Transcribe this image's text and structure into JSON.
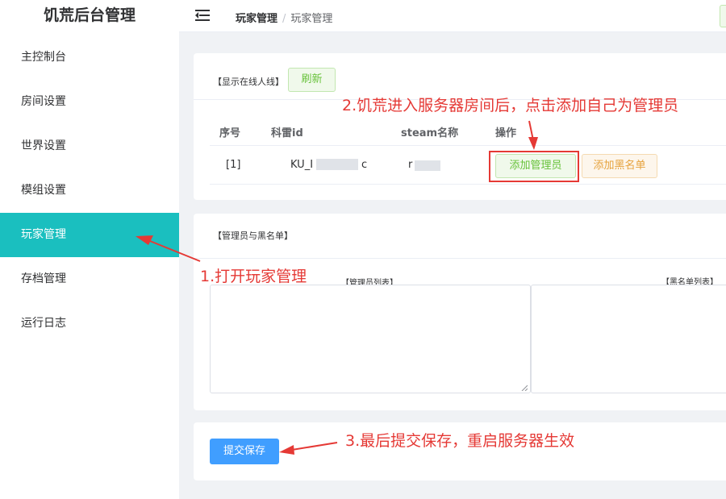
{
  "app": {
    "title": "饥荒后台管理"
  },
  "sidebar": {
    "items": [
      {
        "label": "主控制台"
      },
      {
        "label": "房间设置"
      },
      {
        "label": "世界设置"
      },
      {
        "label": "模组设置"
      },
      {
        "label": "玩家管理"
      },
      {
        "label": "存档管理"
      },
      {
        "label": "运行日志"
      }
    ],
    "active_index": 4
  },
  "header": {
    "breadcrumb": [
      "玩家管理",
      "玩家管理"
    ],
    "separator": "/"
  },
  "online": {
    "label": "【显示在线人线】",
    "refresh_label": "刷新",
    "columns": [
      "序号",
      "科雷id",
      "steam名称",
      "操作"
    ],
    "rows": [
      {
        "index": "[1]",
        "klei_id": "KU_I",
        "klei_id_tail": "c",
        "steam_name": "r"
      }
    ],
    "add_admin_label": "添加管理员",
    "add_blacklist_label": "添加黑名单"
  },
  "lists": {
    "title": "【管理员与黑名单】",
    "admin_label": "【管理员列表】",
    "blacklist_label": "【黑名单列表】",
    "admin_value": "",
    "blacklist_value": ""
  },
  "submit": {
    "label": "提交保存"
  },
  "annotations": {
    "step1": "1.打开玩家管理",
    "step2": "2.饥荒进入服务器房间后，点击添加自己为管理员",
    "step3": "3.最后提交保存，重启服务器生效"
  },
  "colors": {
    "accent": "#1abfbf",
    "primary": "#409eff",
    "success": "#67c23a",
    "warning": "#e6a23c",
    "annotation": "#e53935"
  },
  "icons": [
    "menu-fold-icon"
  ]
}
